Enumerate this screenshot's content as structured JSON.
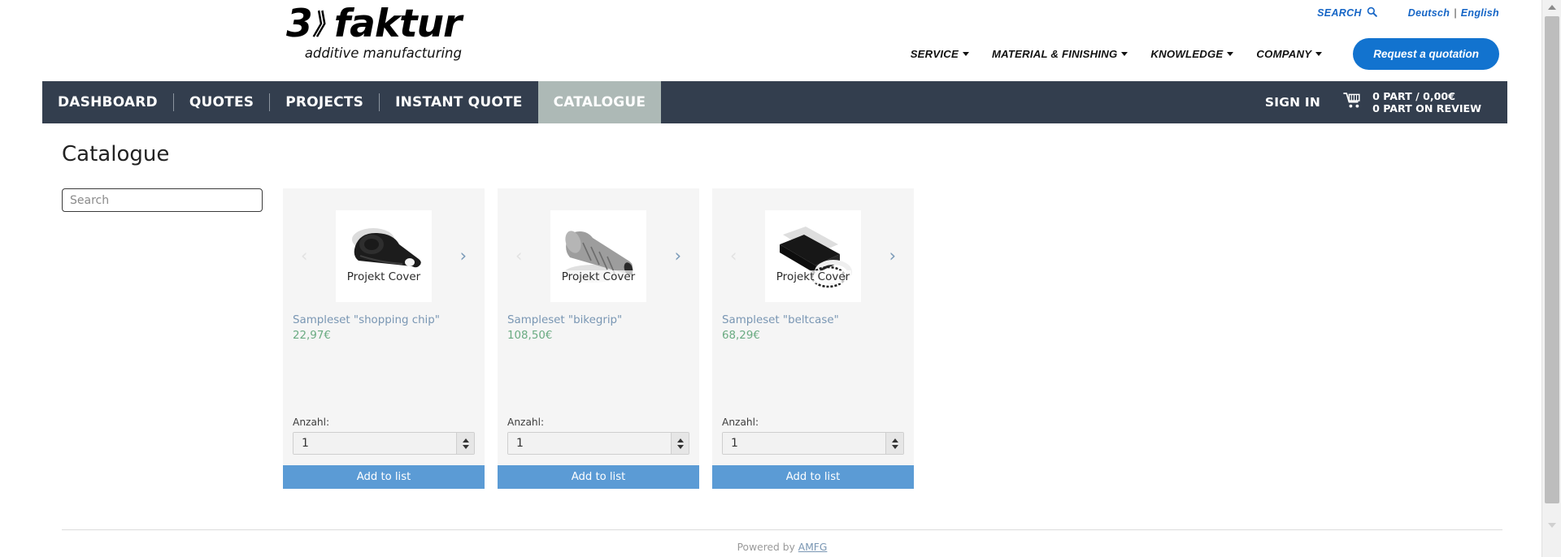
{
  "brand": {
    "logo_main": "3",
    "logo_wave": "》",
    "logo_word": "faktur",
    "logo_sub": "additive manufacturing"
  },
  "utility": {
    "search_label": "SEARCH",
    "search_icon": "search-icon",
    "lang_de": "Deutsch",
    "lang_sep": "|",
    "lang_en": "English"
  },
  "main_nav": {
    "items": [
      {
        "label": "SERVICE",
        "has_caret": true
      },
      {
        "label": "MATERIAL & FINISHING",
        "has_caret": true
      },
      {
        "label": "KNOWLEDGE",
        "has_caret": true
      },
      {
        "label": "COMPANY",
        "has_caret": true
      }
    ],
    "cta_label": "Request a quotation",
    "cta_color": "#1273cf"
  },
  "appbar": {
    "tabs": [
      {
        "label": "DASHBOARD",
        "active": false
      },
      {
        "label": "QUOTES",
        "active": false
      },
      {
        "label": "PROJECTS",
        "active": false
      },
      {
        "label": "INSTANT QUOTE",
        "active": false
      },
      {
        "label": "CATALOGUE",
        "active": true
      }
    ],
    "sign_in": "SIGN IN",
    "cart_icon": "shopping-cart-icon",
    "cart_line1": "0 PART / 0,00€",
    "cart_line2": "0 PART ON REVIEW",
    "bg_color": "#333e4e",
    "active_color": "#adb9b6"
  },
  "main": {
    "page_title": "Catalogue",
    "search_placeholder": "Search",
    "search_value": "",
    "products": [
      {
        "thumb_label": "Projekt Cover",
        "title": "Sampleset \"shopping chip\"",
        "price": "22,97€",
        "qty_label": "Anzahl:",
        "qty_value": "1",
        "add_label": "Add to list"
      },
      {
        "thumb_label": "Projekt Cover",
        "title": "Sampleset \"bikegrip\"",
        "price": "108,50€",
        "qty_label": "Anzahl:",
        "qty_value": "1",
        "add_label": "Add to list"
      },
      {
        "thumb_label": "Projekt Cover",
        "title": "Sampleset \"beltcase\"",
        "price": "68,29€",
        "qty_label": "Anzahl:",
        "qty_value": "1",
        "add_label": "Add to list"
      }
    ],
    "arrow_prev": "‹",
    "arrow_next": "›",
    "title_color": "#7996b3",
    "price_color": "#6aab82",
    "add_btn_color": "#5b9bd5"
  },
  "footer": {
    "powered_by": "Powered by",
    "link_label": "AMFG"
  }
}
